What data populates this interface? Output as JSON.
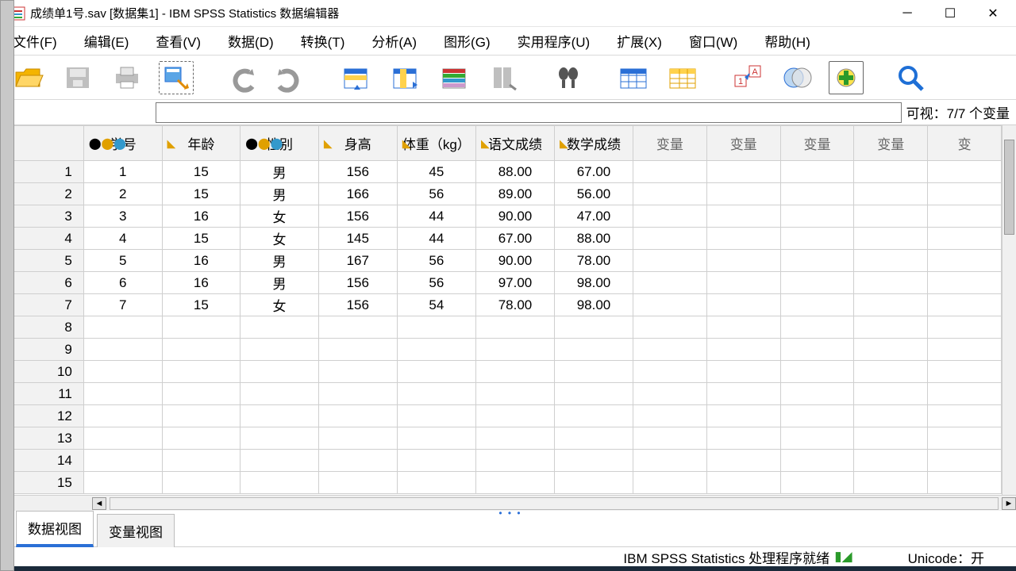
{
  "title": "成绩单1号.sav [数据集1] - IBM SPSS Statistics 数据编辑器",
  "menus": {
    "file": "文件(F)",
    "edit": "编辑(E)",
    "view": "查看(V)",
    "data": "数据(D)",
    "transform": "转换(T)",
    "analyze": "分析(A)",
    "graphs": "图形(G)",
    "utilities": "实用程序(U)",
    "extensions": "扩展(X)",
    "window": "窗口(W)",
    "help": "帮助(H)"
  },
  "visibleVars": "可视：7/7 个变量",
  "columns": [
    "学号",
    "年龄",
    "性别",
    "身高",
    "体重（kg）",
    "语文成绩",
    "数学成绩"
  ],
  "extraVarHeader": "变量",
  "extraVarCount": 5,
  "varTypes": [
    "nominal",
    "scale",
    "nominal",
    "scale",
    "scale",
    "scale",
    "scale"
  ],
  "rows": [
    [
      "1",
      "15",
      "男",
      "156",
      "45",
      "88.00",
      "67.00"
    ],
    [
      "2",
      "15",
      "男",
      "166",
      "56",
      "89.00",
      "56.00"
    ],
    [
      "3",
      "16",
      "女",
      "156",
      "44",
      "90.00",
      "47.00"
    ],
    [
      "4",
      "15",
      "女",
      "145",
      "44",
      "67.00",
      "88.00"
    ],
    [
      "5",
      "16",
      "男",
      "167",
      "56",
      "90.00",
      "78.00"
    ],
    [
      "6",
      "16",
      "男",
      "156",
      "56",
      "97.00",
      "98.00"
    ],
    [
      "7",
      "15",
      "女",
      "156",
      "54",
      "78.00",
      "98.00"
    ]
  ],
  "emptyRows": 8,
  "tabs": {
    "data": "数据视图",
    "variable": "变量视图"
  },
  "status": {
    "processor": "IBM SPSS Statistics 处理程序就绪",
    "unicode": "Unicode：开"
  },
  "colWidths": {
    "row": 100,
    "data": 100,
    "extra": 94
  }
}
